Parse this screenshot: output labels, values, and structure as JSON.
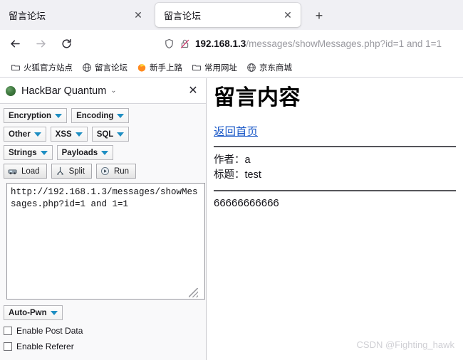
{
  "browser": {
    "tabs": [
      {
        "title": "留言论坛",
        "active": false
      },
      {
        "title": "留言论坛",
        "active": true
      }
    ],
    "tab_close_glyph": "✕",
    "new_tab_glyph": "+",
    "nav": {
      "back_label": "Back",
      "forward_label": "Forward",
      "reload_label": "Reload"
    },
    "url": {
      "host": "192.168.1.3",
      "path": "/messages/showMessages.php?id=1 and 1=1",
      "full": "192.168.1.3/messages/showMessages.php?id=1 and 1=1"
    },
    "bookmarks": [
      {
        "label": "火狐官方站点",
        "icon": "folder-icon"
      },
      {
        "label": "留言论坛",
        "icon": "globe-icon"
      },
      {
        "label": "新手上路",
        "icon": "firefox-icon"
      },
      {
        "label": "常用网址",
        "icon": "folder-icon"
      },
      {
        "label": "京东商城",
        "icon": "globe-icon"
      }
    ]
  },
  "hackbar": {
    "title": "HackBar Quantum",
    "chevron_glyph": "⌄",
    "close_glyph": "✕",
    "menu_buttons": [
      {
        "label": "Encryption"
      },
      {
        "label": "Encoding"
      },
      {
        "label": "Other"
      },
      {
        "label": "XSS"
      },
      {
        "label": "SQL"
      },
      {
        "label": "Strings"
      },
      {
        "label": "Payloads"
      }
    ],
    "action_buttons": [
      {
        "label": "Load",
        "icon": "load-icon"
      },
      {
        "label": "Split",
        "icon": "split-icon"
      },
      {
        "label": "Run",
        "icon": "run-icon"
      }
    ],
    "url_textarea": "http://192.168.1.3/messages/showMessages.php?id=1 and 1=1",
    "auto_pwn_label": "Auto-Pwn",
    "checkboxes": [
      {
        "label": "Enable Post Data",
        "checked": false
      },
      {
        "label": "Enable Referer",
        "checked": false
      }
    ]
  },
  "page": {
    "heading": "留言内容",
    "back_link": "返回首页",
    "author_line": "作者：a",
    "title_line": "标题：test",
    "message_body": "66666666666"
  },
  "watermark": "CSDN @Fighting_hawk",
  "colors": {
    "accent_blue": "#1e8ec2",
    "link_blue": "#1a58c8",
    "chrome_bg": "#f0f0f4",
    "panel_bg": "#f9f9fa"
  }
}
